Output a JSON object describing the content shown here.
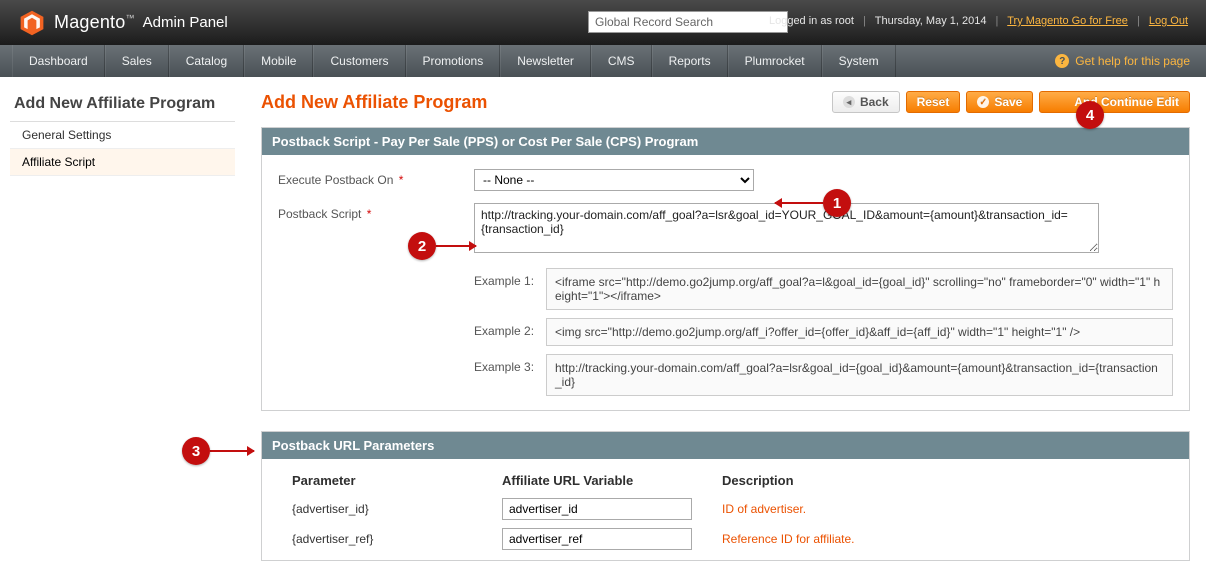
{
  "header": {
    "brand_main": "Magento",
    "brand_sub": "Admin Panel",
    "search_placeholder": "Global Record Search",
    "logged_in_text": "Logged in as root",
    "date": "Thursday, May 1, 2014",
    "link_try": "Try Magento Go for Free",
    "link_logout": "Log Out"
  },
  "nav": {
    "items": [
      "Dashboard",
      "Sales",
      "Catalog",
      "Mobile",
      "Customers",
      "Promotions",
      "Newsletter",
      "CMS",
      "Reports",
      "Plumrocket",
      "System"
    ],
    "help": "Get help for this page"
  },
  "sidebar": {
    "title": "Add New Affiliate Program",
    "items": [
      {
        "label": "General Settings",
        "active": false
      },
      {
        "label": "Affiliate Script",
        "active": true
      }
    ]
  },
  "main": {
    "title": "Add New Affiliate Program",
    "actions": {
      "back": "Back",
      "reset": "Reset",
      "save": "Save",
      "save_continue": "And Continue Edit"
    },
    "panel1": {
      "title": "Postback Script - Pay Per Sale (PPS) or Cost Per Sale (CPS) Program",
      "execute_label": "Execute Postback On",
      "execute_value": "-- None --",
      "script_label": "Postback Script",
      "script_value": "http://tracking.your-domain.com/aff_goal?a=lsr&goal_id=YOUR_GOAL_ID&amount={amount}&transaction_id={transaction_id}",
      "examples": [
        {
          "label": "Example 1:",
          "text": "<iframe src=\"http://demo.go2jump.org/aff_goal?a=l&goal_id={goal_id}\" scrolling=\"no\" frameborder=\"0\" width=\"1\" height=\"1\"></iframe>"
        },
        {
          "label": "Example 2:",
          "text": "<img src=\"http://demo.go2jump.org/aff_i?offer_id={offer_id}&aff_id={aff_id}\" width=\"1\" height=\"1\" />"
        },
        {
          "label": "Example 3:",
          "text": "http://tracking.your-domain.com/aff_goal?a=lsr&goal_id={goal_id}&amount={amount}&transaction_id={transaction_id}"
        }
      ]
    },
    "panel2": {
      "title": "Postback URL Parameters",
      "columns": [
        "Parameter",
        "Affiliate URL Variable",
        "Description"
      ],
      "rows": [
        {
          "param": "{advertiser_id}",
          "var": "advertiser_id",
          "desc": "ID of advertiser."
        },
        {
          "param": "{advertiser_ref}",
          "var": "advertiser_ref",
          "desc": "Reference ID for affiliate."
        }
      ]
    }
  },
  "callouts": {
    "c1": "1",
    "c2": "2",
    "c3": "3",
    "c4": "4"
  }
}
